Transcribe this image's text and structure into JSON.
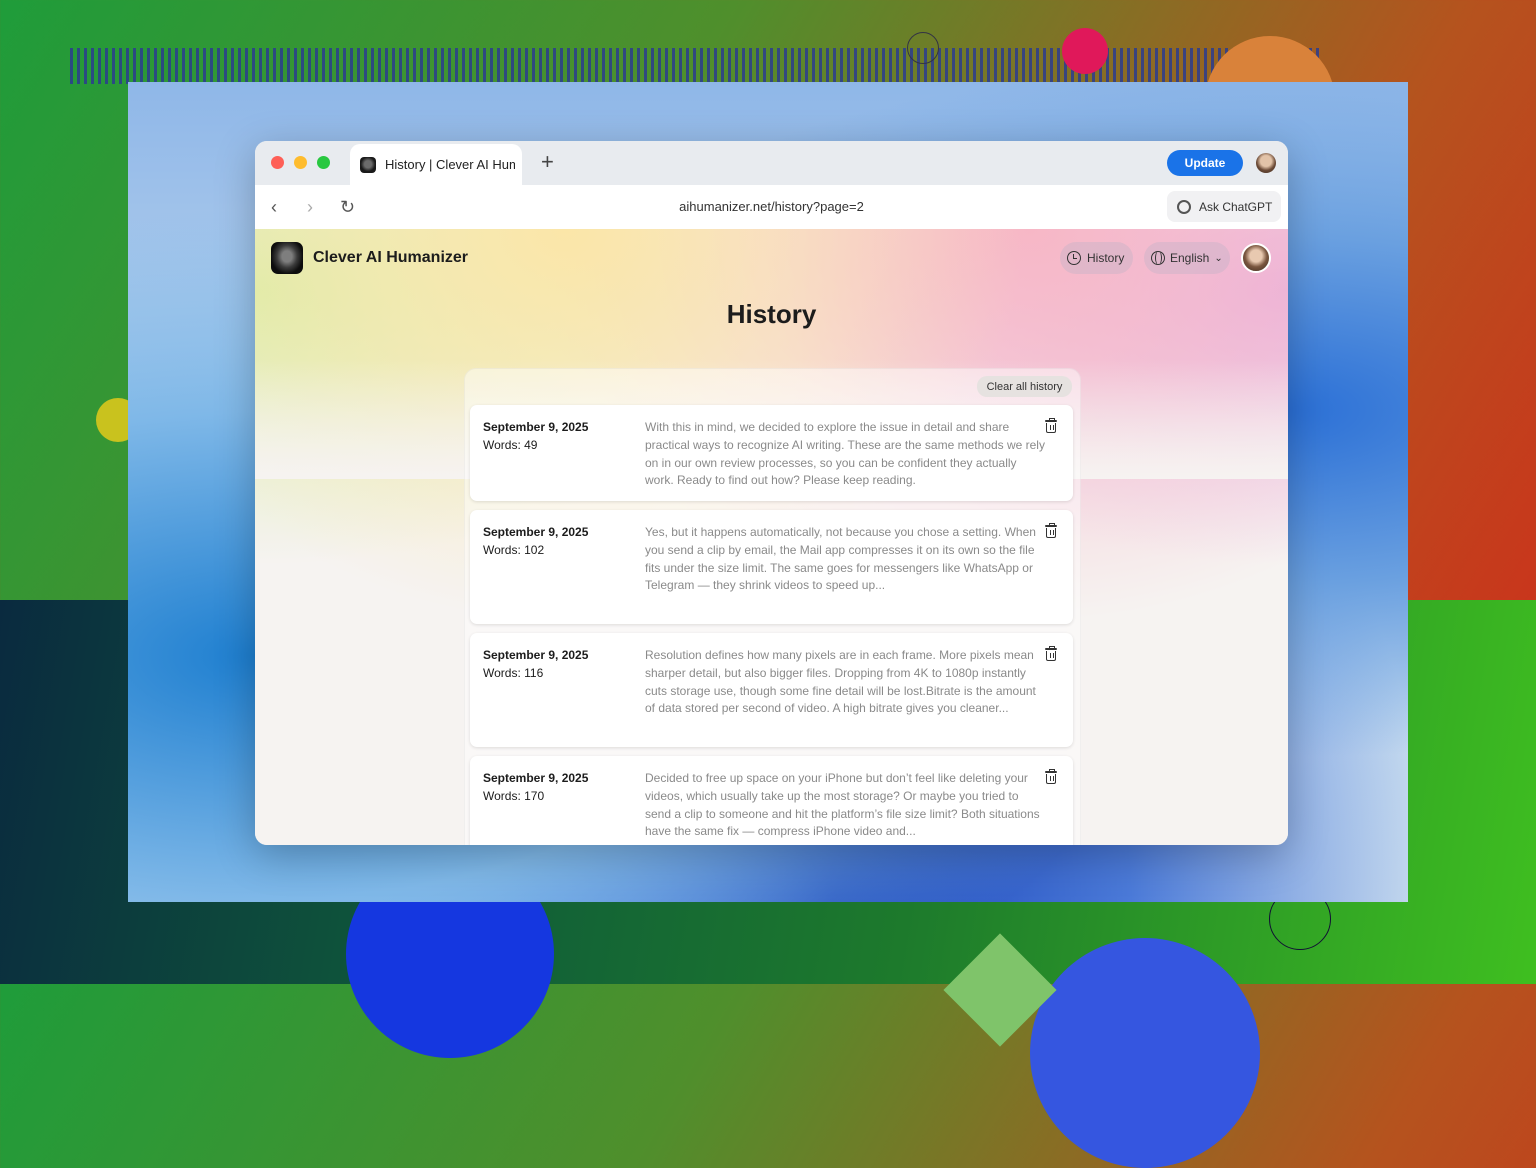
{
  "browser": {
    "tab_title": "History | Clever AI Humanizer",
    "new_tab_symbol": "+",
    "update_label": "Update",
    "url": "aihumanizer.net/history?page=2",
    "ask_label": "Ask ChatGPT"
  },
  "nav_icons": {
    "back": "‹",
    "forward": "›",
    "reload": "↻"
  },
  "site": {
    "brand": "Clever AI Humanizer",
    "history_label": "History",
    "language_label": "English"
  },
  "main": {
    "title": "History",
    "clear_label": "Clear all history",
    "entries": [
      {
        "date": "September 9, 2025",
        "words": "Words: 49",
        "text": "With this in mind, we decided to explore the issue in detail and share practical ways to recognize AI writing. These are the same methods we rely on in our own review processes, so you can be confident they actually work. Ready to find out how? Please keep reading."
      },
      {
        "date": "September 9, 2025",
        "words": "Words: 102",
        "text": "Yes, but it happens automatically, not because you chose a setting. When you send a clip by email, the Mail app compresses it on its own so the file fits under the size limit. The same goes for messengers like WhatsApp or Telegram — they shrink videos to speed up..."
      },
      {
        "date": "September 9, 2025",
        "words": "Words: 116",
        "text": "Resolution defines how many pixels are in each frame. More pixels mean sharper detail, but also bigger files. Dropping from 4K to 1080p instantly cuts storage use, though some fine detail will be lost.Bitrate is the amount of data stored per second of video. A high bitrate gives you cleaner..."
      },
      {
        "date": "September 9, 2025",
        "words": "Words: 170",
        "text": "Decided to free up space on your iPhone but don’t feel like deleting your videos, which usually take up the most storage? Or maybe you tried to send a clip to someone and hit the platform’s file size limit? Both situations have the same fix — compress iPhone video and..."
      }
    ]
  },
  "colors": {
    "accent": "#1a73e8",
    "traffic_red": "#fe5f57",
    "traffic_yellow": "#febc2e",
    "traffic_green": "#28c840"
  }
}
